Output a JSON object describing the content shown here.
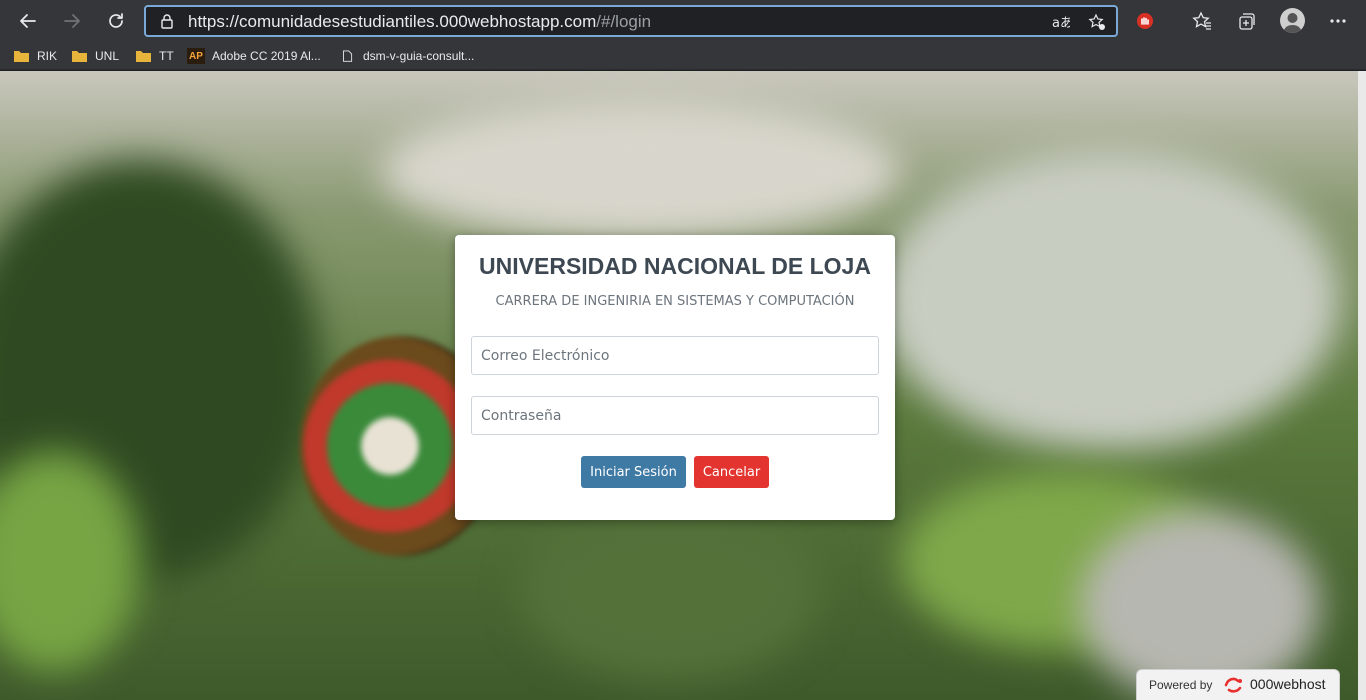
{
  "browser": {
    "url_host": "https://comunidadesestudiantiles.000webhostapp.com",
    "url_rest": "/#/login",
    "icons": [
      "back-icon",
      "forward-icon",
      "refresh-icon",
      "lock-icon",
      "read-aloud-icon",
      "add-favorite-icon",
      "extension-icon",
      "favorites-icon",
      "collections-icon",
      "profile-avatar",
      "more-menu-icon"
    ]
  },
  "bookmarks": [
    {
      "label": "RIK",
      "icon": "folder-icon"
    },
    {
      "label": "UNL",
      "icon": "folder-icon"
    },
    {
      "label": "TT",
      "icon": "folder-icon"
    },
    {
      "label": "Adobe CC 2019 Al...",
      "icon": "ap-icon",
      "icon_text": "AP"
    },
    {
      "label": "dsm-v-guia-consult...",
      "icon": "document-icon"
    }
  ],
  "login": {
    "title": "UNIVERSIDAD NACIONAL DE LOJA",
    "subtitle": "CARRERA DE INGENIRIA EN SISTEMAS Y COMPUTACIÓN",
    "email_placeholder": "Correo Electrónico",
    "password_placeholder": "Contraseña",
    "submit_label": "Iniciar Sesión",
    "cancel_label": "Cancelar"
  },
  "badge": {
    "label": "Powered by",
    "brand": "000webhost"
  },
  "colors": {
    "login_button": "#3f7aa5",
    "cancel_button": "#e3342f",
    "address_focus": "#7aa9d8",
    "chrome": "#35363a"
  }
}
